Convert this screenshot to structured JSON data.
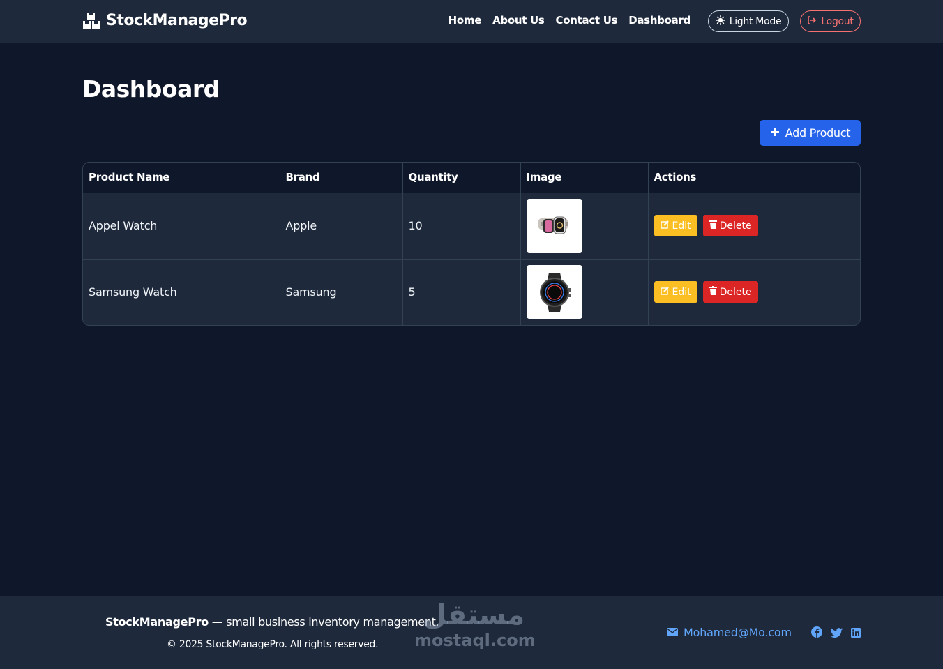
{
  "navbar": {
    "brand": "StockManagePro",
    "links": [
      "Home",
      "About Us",
      "Contact Us",
      "Dashboard"
    ],
    "theme_button": "Light Mode",
    "logout_button": "Logout"
  },
  "main": {
    "title": "Dashboard",
    "add_button": "Add Product",
    "table": {
      "headers": [
        "Product Name",
        "Brand",
        "Quantity",
        "Image",
        "Actions"
      ],
      "rows": [
        {
          "name": "Appel Watch",
          "brand": "Apple",
          "quantity": "10",
          "image": "apple-watch-image",
          "edit": "Edit",
          "delete": "Delete"
        },
        {
          "name": "Samsung Watch",
          "brand": "Samsung",
          "quantity": "5",
          "image": "samsung-watch-image",
          "edit": "Edit",
          "delete": "Delete"
        }
      ]
    }
  },
  "footer": {
    "brand": "StockManagePro",
    "tagline": " — small business inventory management.",
    "copyright": "© 2025 StockManagePro. All rights reserved.",
    "email": "Mohamed@Mo.com",
    "social_icons": [
      "facebook-icon",
      "twitter-icon",
      "linkedin-icon"
    ]
  },
  "watermark": {
    "arabic": "مستقل",
    "latin": "mostaql.com"
  },
  "colors": {
    "background": "#0f172a",
    "surface": "#1e293b",
    "primary": "#2563eb",
    "edit": "#fbbf24",
    "delete": "#dc2626",
    "logout": "#f87171",
    "link": "#60a5fa"
  }
}
